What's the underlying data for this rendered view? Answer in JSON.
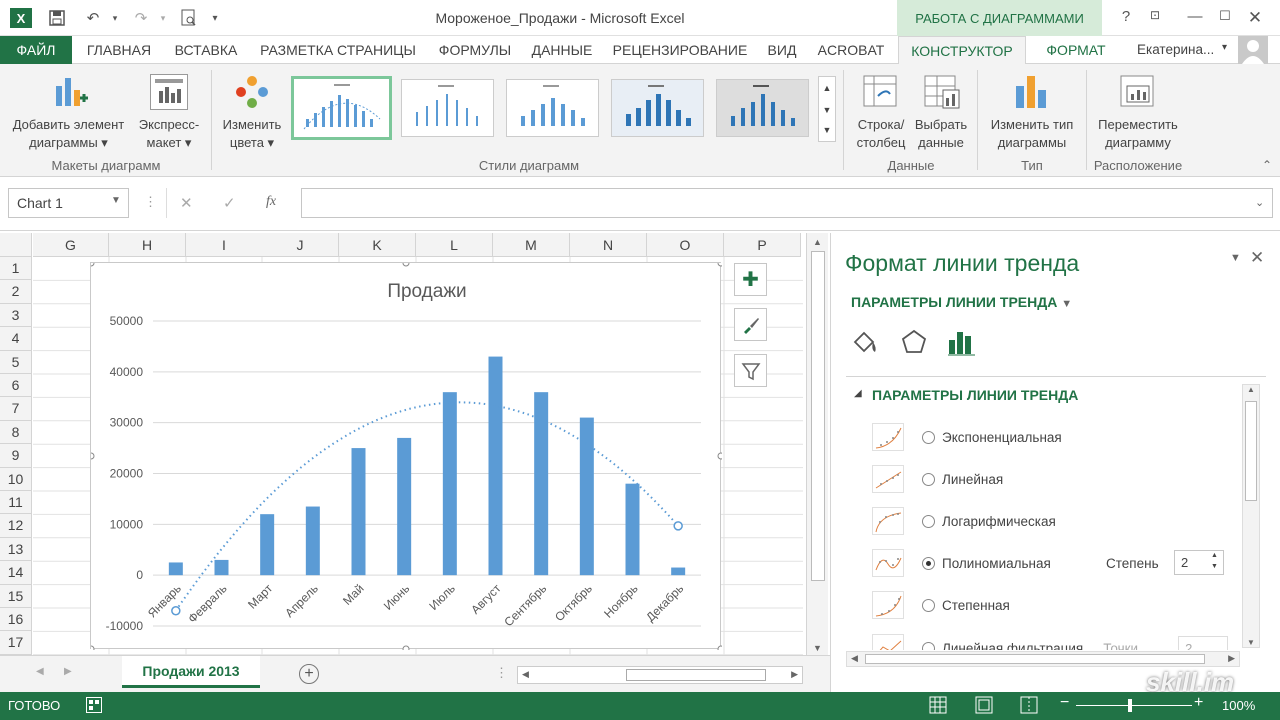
{
  "window": {
    "title": "Мороженое_Продажи - Microsoft Excel",
    "context_tab": "РАБОТА С ДИАГРАММАМИ",
    "user": "Екатерина...",
    "help": "?"
  },
  "tabs": [
    "ФАЙЛ",
    "ГЛАВНАЯ",
    "ВСТАВКА",
    "РАЗМЕТКА СТРАНИЦЫ",
    "ФОРМУЛЫ",
    "ДАННЫЕ",
    "РЕЦЕНЗИРОВАНИЕ",
    "ВИД",
    "ACROBAT",
    "КОНСТРУКТОР",
    "ФОРМАТ"
  ],
  "ribbon": {
    "add_element": [
      "Добавить элемент",
      "диаграммы ▾"
    ],
    "express_layout": [
      "Экспресс-",
      "макет ▾"
    ],
    "change_colors": [
      "Изменить",
      "цвета ▾"
    ],
    "group_layouts": "Макеты диаграмм",
    "group_styles": "Стили диаграмм",
    "row_col": [
      "Строка/",
      "столбец"
    ],
    "select_data": [
      "Выбрать",
      "данные"
    ],
    "group_data": "Данные",
    "change_type": [
      "Изменить тип",
      "диаграммы"
    ],
    "group_type": "Тип",
    "move_chart": [
      "Переместить",
      "диаграмму"
    ],
    "group_location": "Расположение"
  },
  "formula": {
    "name_box": "Chart 1",
    "fx": "fx",
    "cancel": "✕",
    "enter": "✓"
  },
  "columns": [
    "G",
    "H",
    "I",
    "J",
    "K",
    "L",
    "M",
    "N",
    "O",
    "P"
  ],
  "rows": [
    "1",
    "2",
    "3",
    "4",
    "5",
    "6",
    "7",
    "8",
    "9",
    "10",
    "11",
    "12",
    "13",
    "14",
    "15",
    "16",
    "17"
  ],
  "chart_data": {
    "type": "bar",
    "title": "Продажи",
    "categories": [
      "Январь",
      "Февраль",
      "Март",
      "Апрель",
      "Май",
      "Июнь",
      "Июль",
      "Август",
      "Сентябрь",
      "Октябрь",
      "Ноябрь",
      "Декабрь"
    ],
    "values": [
      2500,
      3000,
      12000,
      13500,
      25000,
      27000,
      36000,
      43000,
      36000,
      31000,
      18000,
      1500
    ],
    "ylim": [
      -10000,
      50000
    ],
    "yticks": [
      "50000",
      "40000",
      "30000",
      "20000",
      "10000",
      "0",
      "-10000"
    ],
    "trendline": "polynomial",
    "trend_start": -7000,
    "trend_peak": 34000,
    "trend_end": 9500,
    "bar_color": "#5b9bd5",
    "trend_color": "#5b9bd5",
    "grid": true
  },
  "pane": {
    "title": "Формат линии тренда",
    "dropdown": "ПАРАМЕТРЫ ЛИНИИ ТРЕНДА",
    "section": "ПАРАМЕТРЫ ЛИНИИ ТРЕНДА",
    "options": [
      "Экспоненциальная",
      "Линейная",
      "Логарифмическая",
      "Полиномиальная",
      "Степенная",
      "Линейная фильтрация"
    ],
    "selected": "Полиномиальная",
    "degree_label": "Степень",
    "degree_value": "2",
    "points_label": "Точки",
    "points_value": "2"
  },
  "sheet": {
    "tab": "Продажи 2013",
    "add": "+"
  },
  "status": {
    "ready": "ГОТОВО",
    "zoom": "100%"
  },
  "watermark": "skill.im"
}
